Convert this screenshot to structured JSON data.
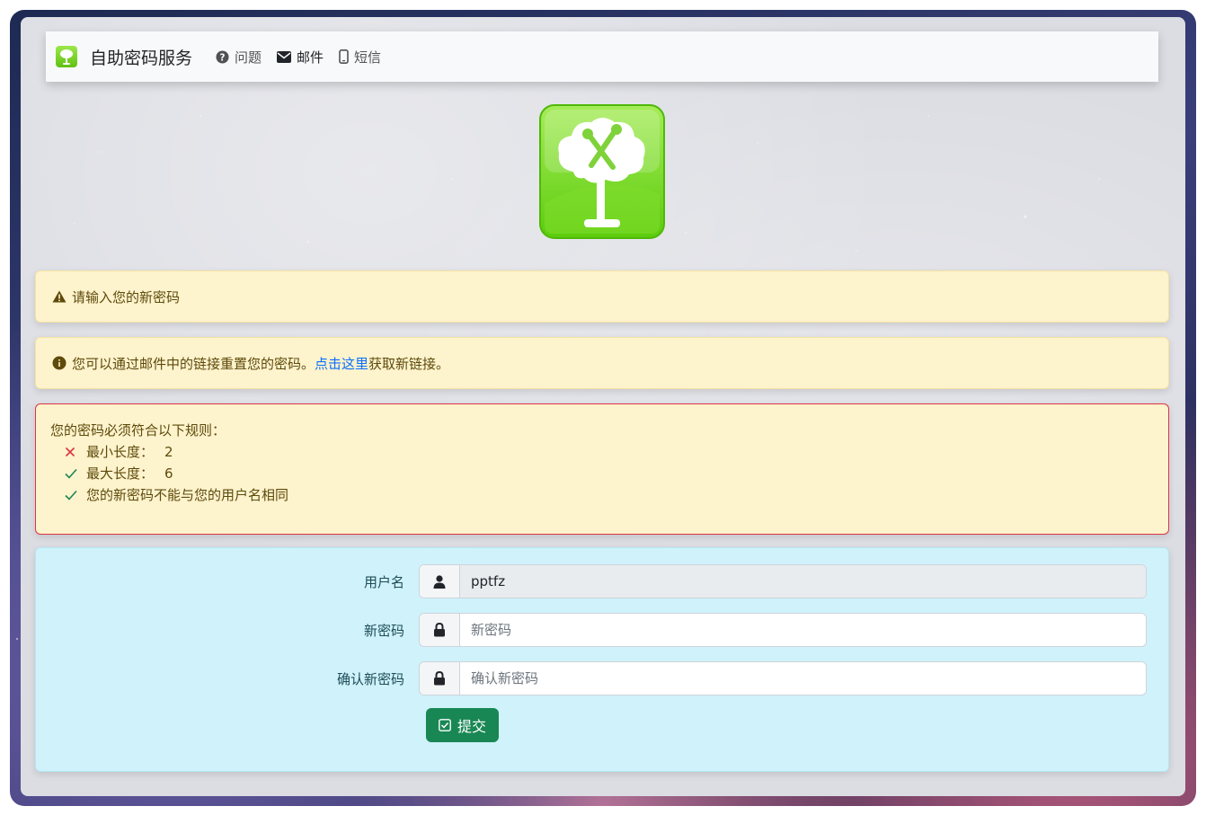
{
  "navbar": {
    "brand": "自助密码服务",
    "links": [
      {
        "label": "问题",
        "icon": "question-circle-icon"
      },
      {
        "label": "邮件",
        "icon": "envelope-icon"
      },
      {
        "label": "短信",
        "icon": "mobile-icon"
      }
    ]
  },
  "alerts": {
    "warning": "请输入您的新密码",
    "info_prefix": "您可以通过邮件中的链接重置您的密码。",
    "info_link": "点击这里",
    "info_suffix": "获取新链接。"
  },
  "rules": {
    "title": "您的密码必须符合以下规则：",
    "items": [
      {
        "label": "最小长度：",
        "value": "2",
        "status": "fail"
      },
      {
        "label": "最大长度：",
        "value": "6",
        "status": "pass"
      },
      {
        "label": "您的新密码不能与您的用户名相同",
        "value": "",
        "status": "pass"
      }
    ]
  },
  "form": {
    "username": {
      "label": "用户名",
      "value": "pptfz",
      "icon": "user-icon"
    },
    "new_password": {
      "label": "新密码",
      "placeholder": "新密码",
      "icon": "lock-icon"
    },
    "confirm_password": {
      "label": "确认新密码",
      "placeholder": "确认新密码",
      "icon": "lock-icon"
    },
    "submit": "提交"
  },
  "colors": {
    "warning_bg": "#fdf3cd",
    "danger_border": "#dc3545",
    "panel_bg": "#cff2fb",
    "submit_bg": "#198754",
    "link": "#0d6efd"
  }
}
